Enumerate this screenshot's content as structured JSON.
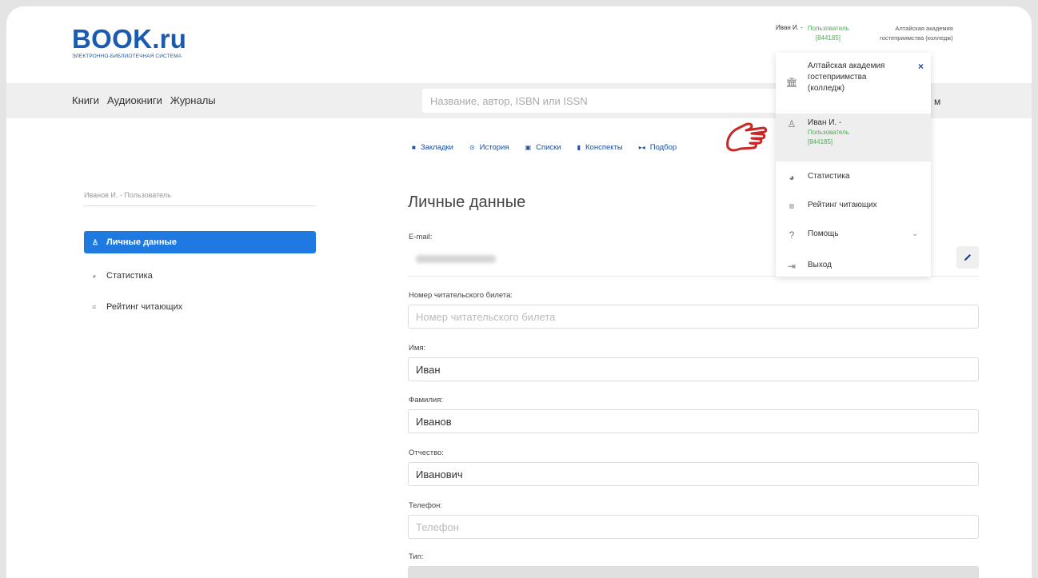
{
  "logo": {
    "title": "BOOK.ru",
    "subtitle": "ЭЛЕКТРОННО-БИБЛИОТЕЧНАЯ СИСТЕМА"
  },
  "header_user": {
    "name": "Иван И. -",
    "role": "Пользователь",
    "id": "[844185]",
    "org": "Алтайская академия гостеприимства (колледж)"
  },
  "nav": {
    "links": [
      "Книги",
      "Аудиокниги",
      "Журналы"
    ],
    "search_placeholder": "Название, автор, ISBN или ISSN",
    "right_fragment": "м"
  },
  "sidebar": {
    "user_label": "Иванов И. - Пользователь",
    "items": [
      {
        "label": "Личные данные",
        "icon": "user-icon"
      },
      {
        "label": "Статистика",
        "icon": "pie-icon"
      },
      {
        "label": "Рейтинг читающих",
        "icon": "list-icon"
      }
    ]
  },
  "tabs": [
    {
      "label": "Закладки",
      "icon": "bookmark-icon"
    },
    {
      "label": "История",
      "icon": "history-icon"
    },
    {
      "label": "Списки",
      "icon": "list-icon"
    },
    {
      "label": "Конспекты",
      "icon": "notes-icon"
    },
    {
      "label": "Подбор",
      "icon": "selection-icon"
    }
  ],
  "page_title": "Личные данные",
  "form": {
    "email_label": "E-mail:",
    "card_label": "Номер читательского билета:",
    "card_placeholder": "Номер читательского билета",
    "name_label": "Имя:",
    "name_value": "Иван",
    "surname_label": "Фамилия:",
    "surname_value": "Иванов",
    "patronymic_label": "Отчество:",
    "patronymic_value": "Иванович",
    "phone_label": "Телефон:",
    "phone_placeholder": "Телефон",
    "type_label": "Тип:"
  },
  "dropdown": {
    "close": "×",
    "org": [
      "Алтайская академия",
      "гостеприимства",
      "(колледж)"
    ],
    "user_name": "Иван И. -",
    "user_role": "Пользователь",
    "user_id": "[844185]",
    "stats": "Статистика",
    "rating": "Рейтинг читающих",
    "help": "Помощь",
    "logout": "Выход"
  },
  "colors": {
    "brand": "#1a5bb0",
    "active": "#1e7ae0",
    "pointer": "#c62828",
    "role": "#4caf50"
  }
}
